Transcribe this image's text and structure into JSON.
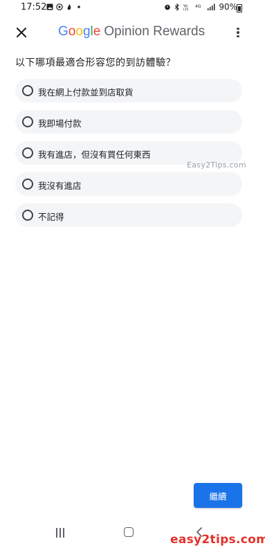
{
  "status_bar": {
    "time": "17:52",
    "battery": "90%",
    "icons_left": [
      "image-icon",
      "whatsapp-icon",
      "notification-icon",
      "dot-icon"
    ],
    "icons_right": [
      "alarm-icon",
      "bluetooth-icon",
      "volte-icon",
      "4g-icon",
      "signal-icon",
      "battery-icon"
    ]
  },
  "app_bar": {
    "logo_google": [
      "G",
      "o",
      "o",
      "g",
      "l",
      "e"
    ],
    "logo_rest": "Opinion Rewards"
  },
  "question": "以下哪項最適合形容您的到訪體驗？",
  "options": [
    {
      "label": "我在網上付款並到店取貨"
    },
    {
      "label": "我即場付款"
    },
    {
      "label": "我有進店，但沒有買任何東西"
    },
    {
      "label": "我沒有進店"
    },
    {
      "label": "不記得"
    }
  ],
  "watermark_small": "Easy2Tips.com",
  "continue_label": "繼續",
  "watermark_large": "easy2tips.com",
  "colors": {
    "accent": "#1a73e8",
    "option_bg": "#f4f5f7",
    "google_blue": "#4285f4",
    "google_red": "#ea4335",
    "google_yellow": "#fbbc05",
    "google_green": "#34a853",
    "watermark_red": "#e2312b"
  }
}
